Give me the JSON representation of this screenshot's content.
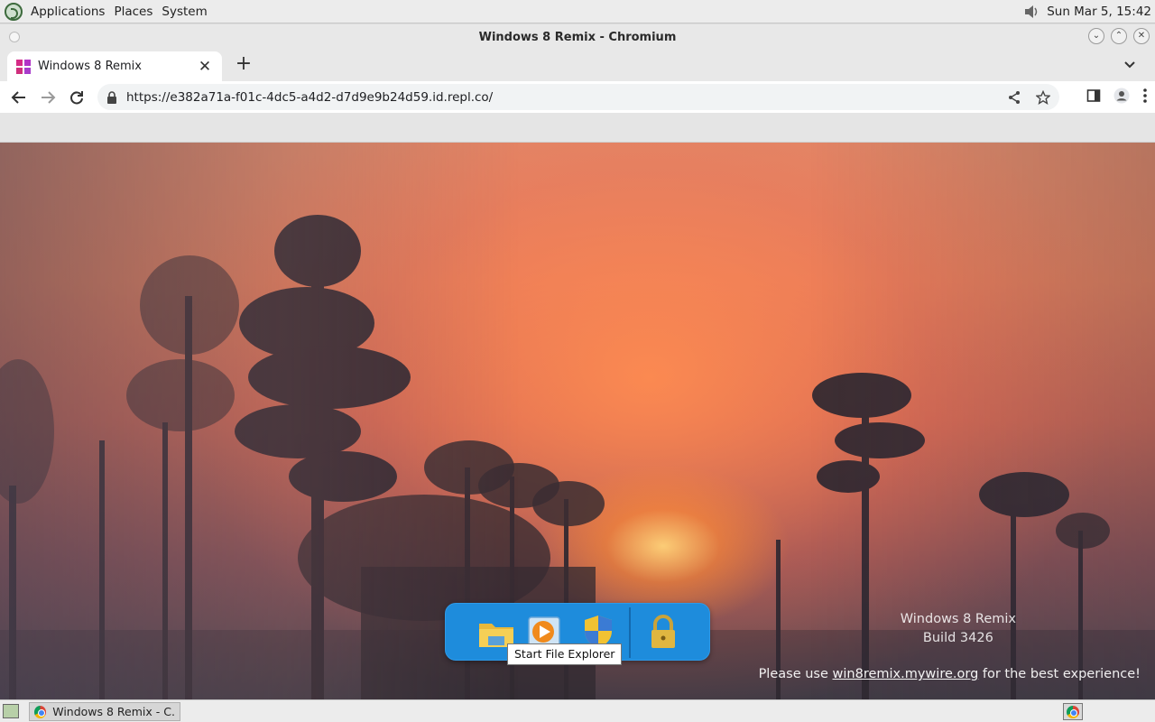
{
  "top_panel": {
    "menus": [
      "Applications",
      "Places",
      "System"
    ],
    "clock": "Sun Mar  5, 15:42"
  },
  "window": {
    "title": "Windows 8 Remix - Chromium"
  },
  "browser": {
    "tab": {
      "title": "Windows 8 Remix"
    },
    "url": "https://e382a71a-f01c-4dc5-a4d2-d7d9e9b24d59.id.repl.co/"
  },
  "page": {
    "watermark_line1": "Windows 8 Remix",
    "watermark_line2": "Build 3426",
    "notice_prefix": "Please use ",
    "notice_link": "win8remix.mywire.org",
    "notice_suffix": " for the best experience!",
    "dock": {
      "items": [
        "file-explorer",
        "media-player",
        "security-shield",
        "lock"
      ],
      "tooltip": "Start File Explorer"
    }
  },
  "taskbar": {
    "task_label": "Windows 8 Remix - C..."
  },
  "colors": {
    "dock": "#1e8cdc",
    "panel": "#ececec",
    "tab_favicon": "#c425a8"
  }
}
